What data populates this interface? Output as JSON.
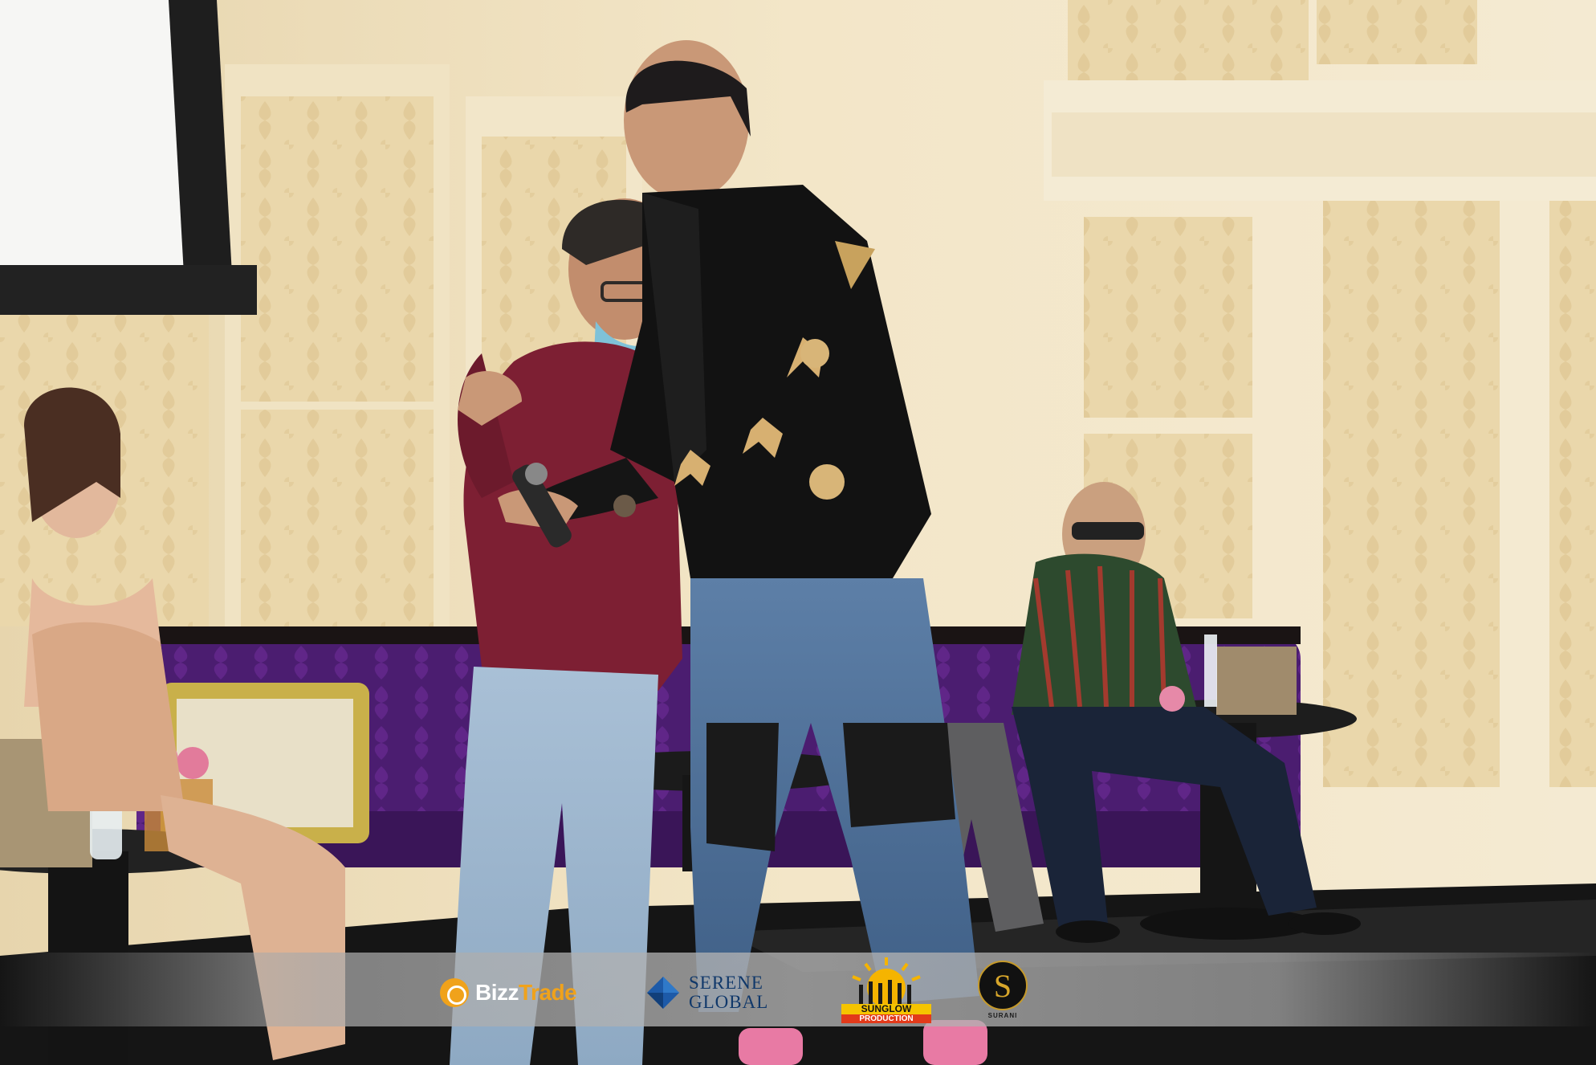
{
  "photo": {
    "subject": "event-stage-photo"
  },
  "sponsors": {
    "bizztrade": {
      "name_part1": "Bizz",
      "name_part2": "Trade"
    },
    "serene": {
      "line1": "SERENE",
      "line2": "GLOBAL"
    },
    "sunglow": {
      "line1": "SUNGLOW",
      "line2": "PRODUCTION"
    },
    "surani": {
      "initial": "S",
      "name": "SURANI"
    }
  },
  "colors": {
    "wall": "#efe3c6",
    "sofa": "#4a1f6e",
    "stage": "#1a1a1a",
    "bizz_accent": "#f0a21b",
    "serene_blue": "#10386a"
  }
}
